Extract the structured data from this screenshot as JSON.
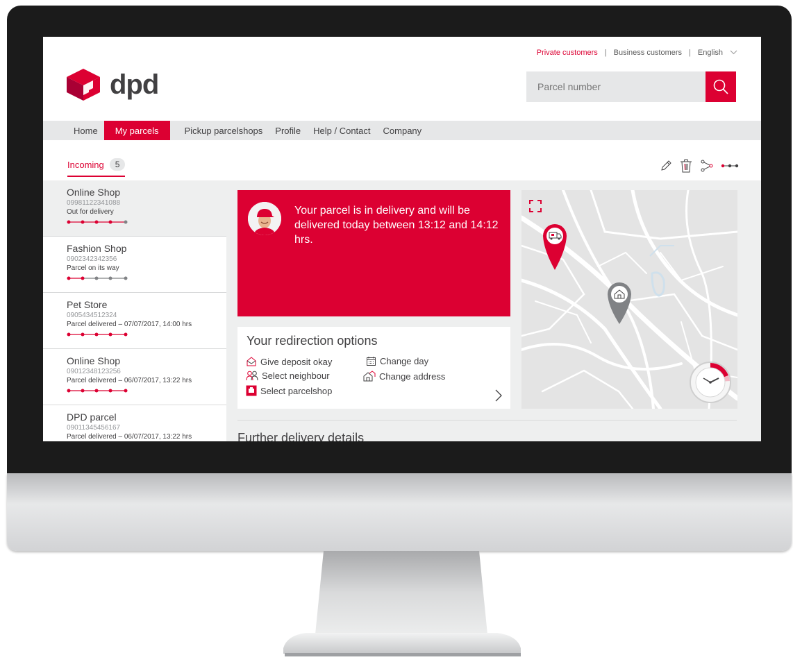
{
  "header": {
    "top_links": [
      "Private customers",
      "Business customers",
      "English"
    ],
    "logo_text": "dpd",
    "search_placeholder": "Parcel number"
  },
  "nav": {
    "items": [
      "Home",
      "My parcels",
      "Pickup parcelshops",
      "Profile",
      "Help / Contact",
      "Company"
    ]
  },
  "tabs": {
    "incoming_label": "Incoming",
    "incoming_count": "5"
  },
  "parcels": [
    {
      "name": "Online Shop",
      "number": "09981122341088",
      "status": "Out for delivery"
    },
    {
      "name": "Fashion Shop",
      "number": "0902342342356",
      "status": "Parcel on its way"
    },
    {
      "name": "Pet Store",
      "number": "0905434512324",
      "status": "Parcel delivered – 07/07/2017, 14:00 hrs"
    },
    {
      "name": "Online Shop",
      "number": "09012348123256",
      "status": "Parcel delivered – 06/07/2017, 13:22 hrs"
    },
    {
      "name": "DPD parcel",
      "number": "09011345456167",
      "status": "Parcel delivered – 06/07/2017, 13:22 hrs"
    }
  ],
  "delivery": {
    "message": "Your parcel is in delivery and will be delivered today between 13:12 and 14:12 hrs."
  },
  "redirection": {
    "title": "Your redirection options",
    "options": [
      "Give deposit okay",
      "Change day",
      "Select neighbour",
      "Change address",
      "Select parcelshop"
    ]
  },
  "further": {
    "title": "Further delivery details"
  },
  "colors": {
    "brand_red": "#dc0032",
    "text_dark": "#414042",
    "nav_grey": "#e6e7e8"
  }
}
